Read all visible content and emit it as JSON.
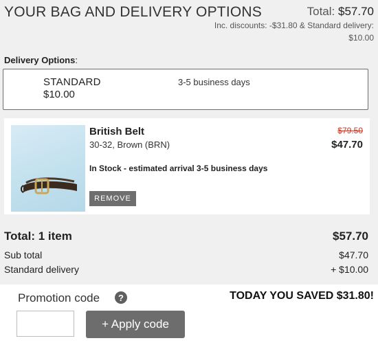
{
  "header": {
    "title": "YOUR BAG AND DELIVERY OPTIONS",
    "total_label": "Total:",
    "total_value": "$57.70",
    "discount_line": "Inc. discounts: -$31.80 & Standard delivery:",
    "delivery_line": "$10.00"
  },
  "delivery": {
    "label": "Delivery Options",
    "colon": ":",
    "option": {
      "name": "STANDARD",
      "price": "$10.00",
      "days": "3-5 business days"
    }
  },
  "item": {
    "name": "British Belt",
    "variant": "30-32, Brown (BRN)",
    "stock": "In Stock - estimated arrival 3-5 business days",
    "remove_label": "REMOVE",
    "was_price": "$79.50",
    "price": "$47.70",
    "image_icon": "belt-photo"
  },
  "summary": {
    "total_label": "Total: 1 item",
    "total_value": "$57.70",
    "subtotal_label": "Sub total",
    "subtotal_value": "$47.70",
    "delivery_label": "Standard delivery",
    "delivery_value": "+ $10.00"
  },
  "promo": {
    "label": "Promotion code",
    "help_icon": "?",
    "saved_text": "TODAY YOU SAVED $31.80!",
    "input_value": "",
    "input_placeholder": "",
    "apply_label": "+ Apply code"
  },
  "colors": {
    "background": "#f0f0f0",
    "button_gray": "#6d6d6d",
    "strike_red": "#c0392b"
  }
}
